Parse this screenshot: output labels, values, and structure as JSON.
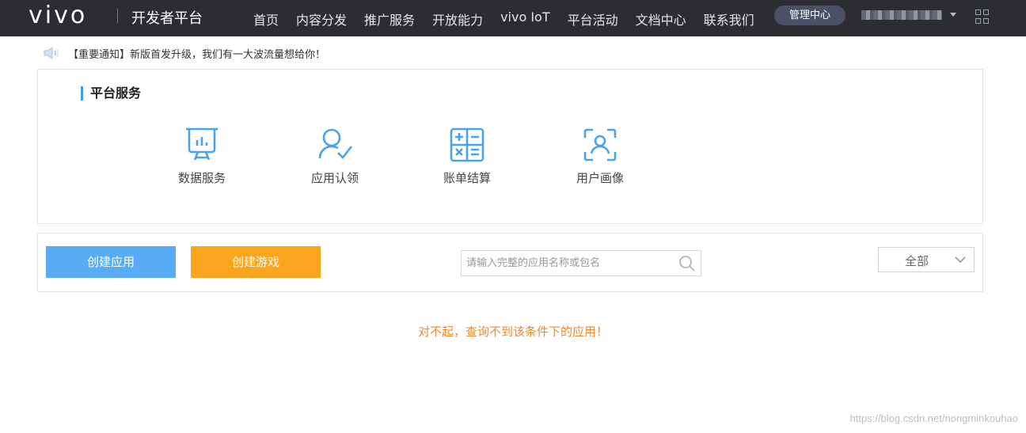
{
  "header": {
    "logo": "vivo",
    "platform_title": "开发者平台",
    "nav": [
      "首页",
      "内容分发",
      "推广服务",
      "开放能力",
      "vivo IoT",
      "平台活动",
      "文档中心",
      "联系我们"
    ],
    "management_button": "管理中心"
  },
  "notice": {
    "text": "【重要通知】新版首发升级，我们有一大波流量想给你！"
  },
  "services": {
    "title": "平台服务",
    "items": [
      {
        "label": "数据服务",
        "icon": "presentation-chart-icon"
      },
      {
        "label": "应用认领",
        "icon": "user-check-icon"
      },
      {
        "label": "账单结算",
        "icon": "calculator-icon"
      },
      {
        "label": "用户画像",
        "icon": "user-scan-icon"
      }
    ]
  },
  "actions": {
    "create_app": "创建应用",
    "create_game": "创建游戏",
    "search_placeholder": "请输入完整的应用名称或包名",
    "filter_value": "全部"
  },
  "empty_message": "对不起，查询不到该条件下的应用！",
  "watermark": "https://blog.csdn.net/nongminkouhao",
  "colors": {
    "topbar": "#2b2d33",
    "accent_blue": "#3aa0ea",
    "create_app_button": "#58acf5",
    "create_game_button": "#fba41e",
    "empty_message": "#f08a2a"
  }
}
